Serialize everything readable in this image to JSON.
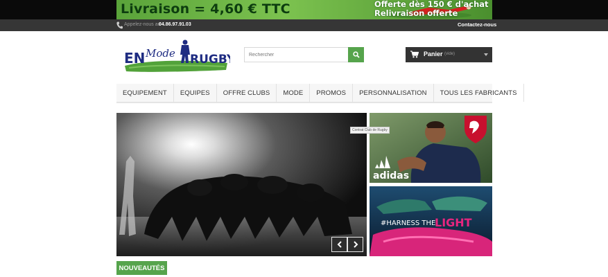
{
  "promo": {
    "left_text": "Livraison = 4,60 € TTC",
    "right_line1": "Offerte dès 150 € d'achat",
    "right_line2": "Relivraison offerte"
  },
  "topnav": {
    "call_label": "Appelez-nous au",
    "phone": "04.86.97.91.03",
    "contact": "Contactez-nous"
  },
  "logo": {
    "alt": "EN Mode RUGBY",
    "word_en": "EN",
    "word_mode": "Mode",
    "word_rugby": "RUGBY"
  },
  "search": {
    "placeholder": "Rechercher"
  },
  "cart": {
    "label": "Panier",
    "status": "(vide)"
  },
  "menu": {
    "items": [
      "EQUIPEMENT",
      "EQUIPES",
      "OFFRE CLUBS",
      "MODE",
      "PROMOS",
      "PERSONNALISATION",
      "TOUS LES FABRICANTS"
    ]
  },
  "banners": {
    "tooltip": "Contrat Club de Rugby",
    "adidas": "adidas",
    "harness_prefix": "#HARNESS THE",
    "harness_word": "LIGHT"
  },
  "sections": {
    "new_products": "NOUVEAUTÉS"
  },
  "colors": {
    "accent_green": "#56a44c",
    "dark_bar": "#363636",
    "cart_bg": "#333333"
  }
}
